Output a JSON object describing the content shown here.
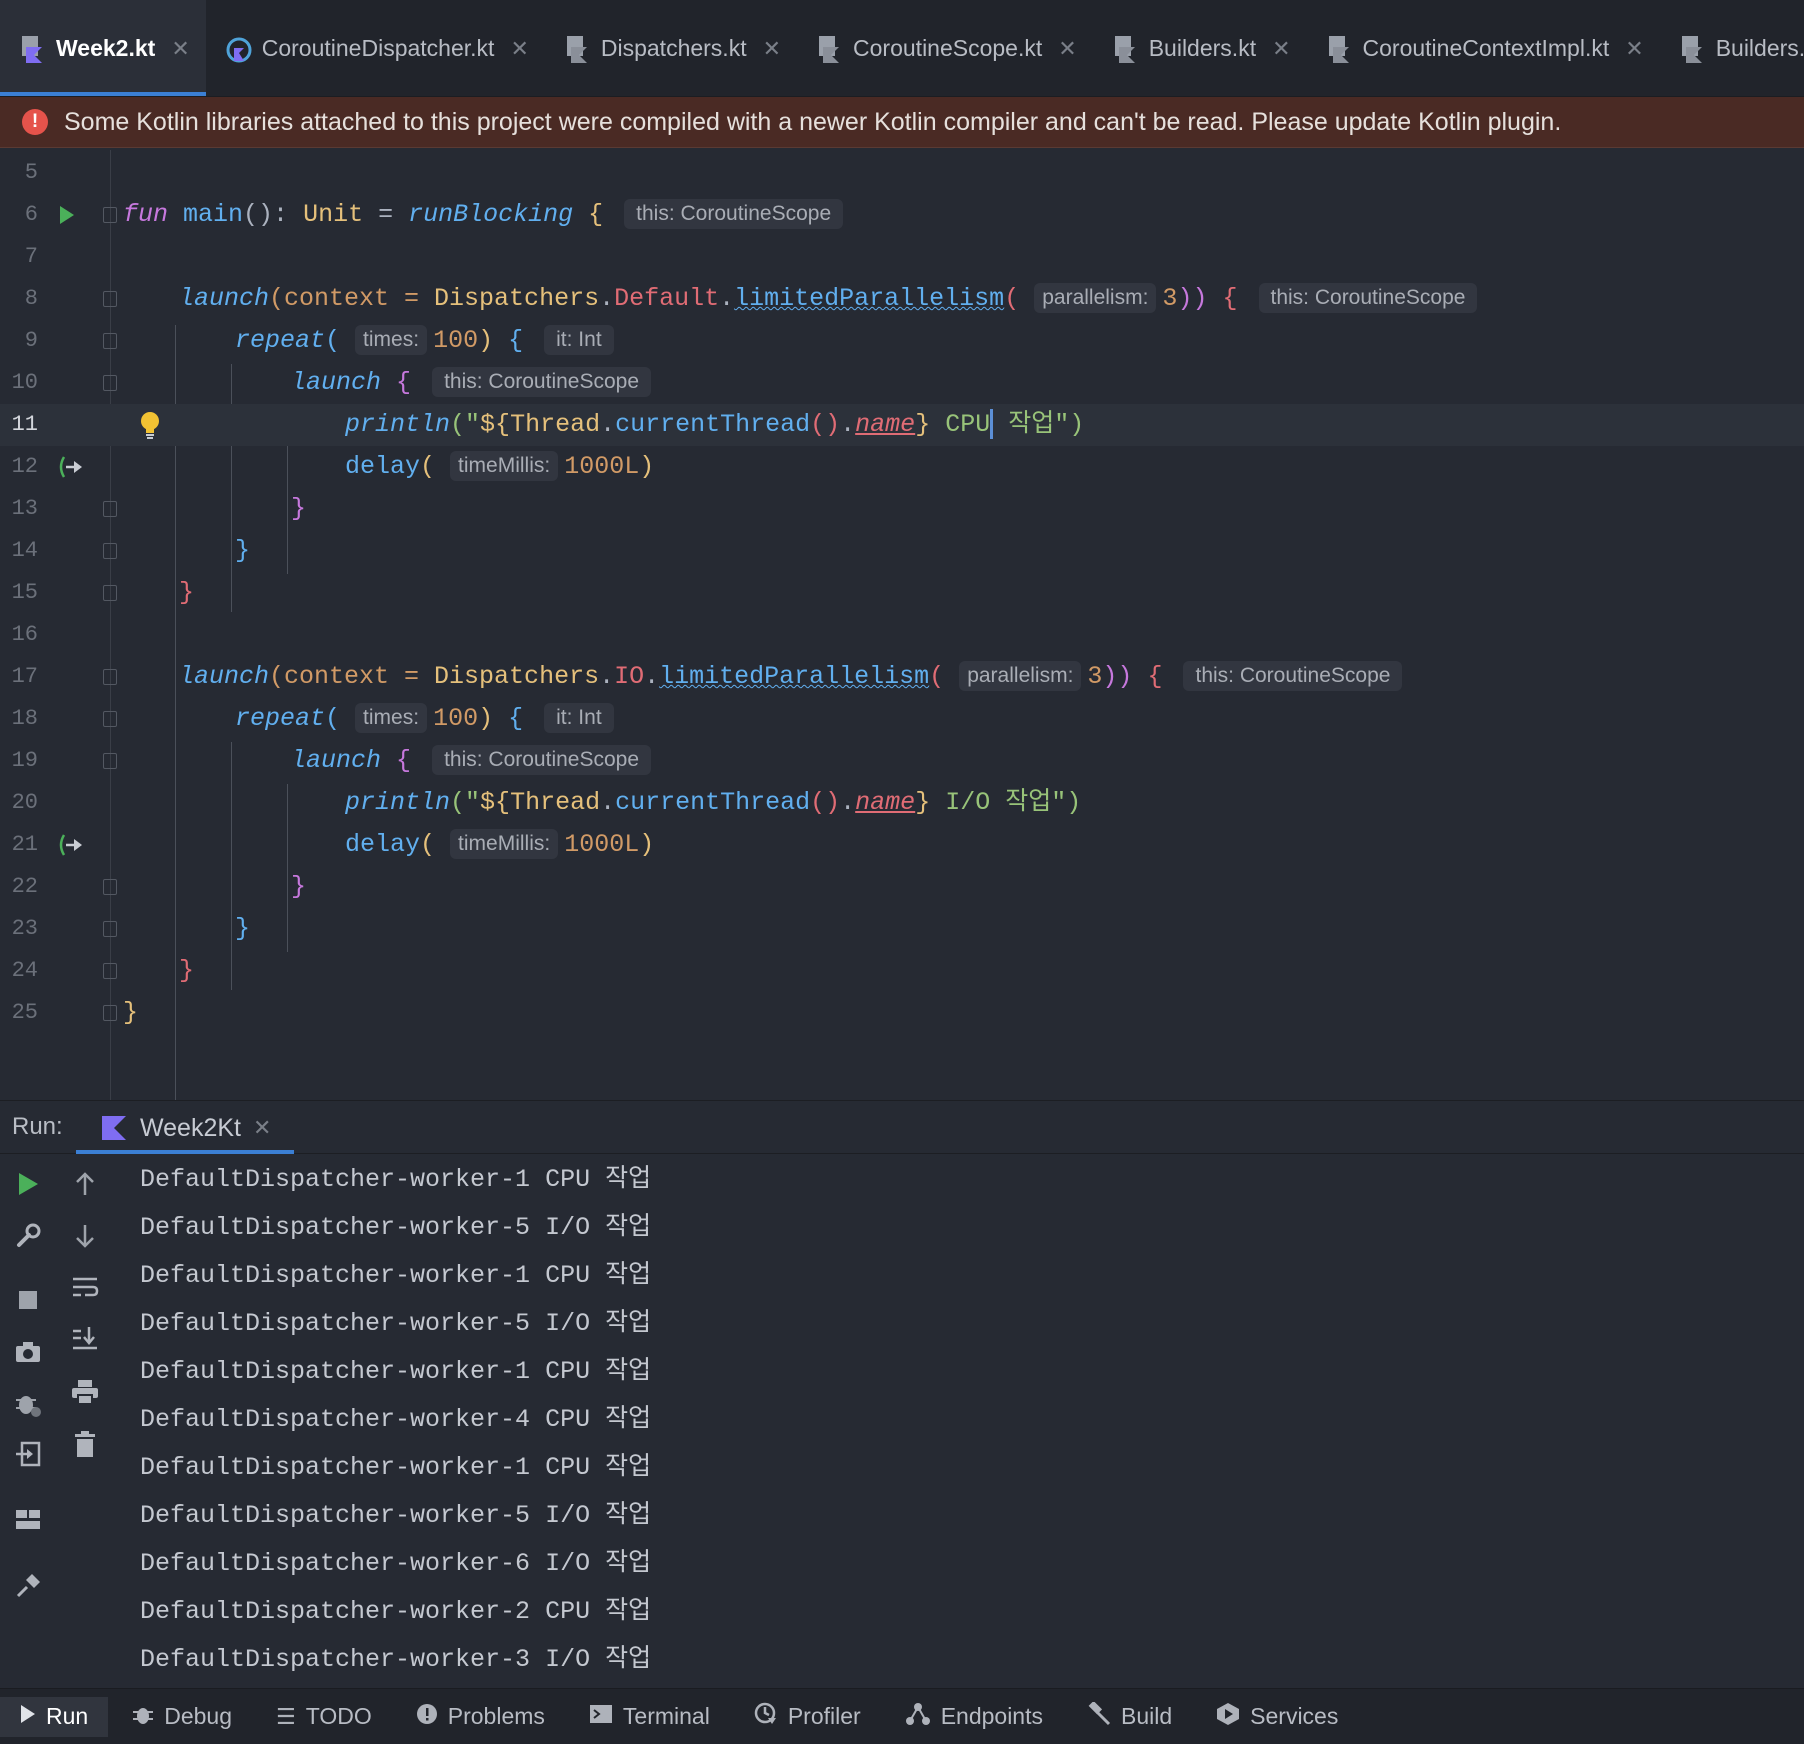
{
  "tabs": [
    {
      "label": "Week2.kt",
      "active": true,
      "icon": "kotlin-file-icon"
    },
    {
      "label": "CoroutineDispatcher.kt",
      "active": false,
      "icon": "kotlin-class-icon"
    },
    {
      "label": "Dispatchers.kt",
      "active": false,
      "icon": "kotlin-file-icon"
    },
    {
      "label": "CoroutineScope.kt",
      "active": false,
      "icon": "kotlin-file-icon"
    },
    {
      "label": "Builders.kt",
      "active": false,
      "icon": "kotlin-file-icon"
    },
    {
      "label": "CoroutineContextImpl.kt",
      "active": false,
      "icon": "kotlin-file-icon"
    },
    {
      "label": "Builders.common.kt",
      "active": false,
      "icon": "kotlin-file-icon"
    }
  ],
  "banner": {
    "icon": "error-icon",
    "message": "Some Kotlin libraries attached to this project were compiled with a newer Kotlin compiler and can't be read. Please update Kotlin plugin."
  },
  "editor": {
    "line_numbers": [
      "5",
      "6",
      "7",
      "8",
      "9",
      "10",
      "11",
      "12",
      "13",
      "14",
      "15",
      "16",
      "17",
      "18",
      "19",
      "20",
      "21",
      "22",
      "23",
      "24",
      "25"
    ],
    "current_line": "11",
    "hints": {
      "scope": "this: CoroutineScope",
      "parallelism": "parallelism:",
      "times": "times:",
      "it": "it: Int",
      "timeMillis": "timeMillis:"
    },
    "code": {
      "fun": "fun",
      "main": "main",
      "unit_sig": "(): ",
      "unit": "Unit",
      "eq": " = ",
      "runBlocking": "runBlocking",
      "launch": "launch",
      "context_eq": "(context = ",
      "dispatchers": "Dispatchers",
      "dot": ".",
      "default": "Default",
      "io": "IO",
      "limited": "limitedParallelism",
      "three": "3",
      "repeat": "repeat",
      "hundred": "100",
      "println": "println",
      "str_open": "(\"",
      "interp_open": "${",
      "thread": "Thread",
      "current_thread": "currentThread",
      "parens": "()",
      "name": "name",
      "interp_close": "}",
      "cpu_text": " CPU",
      "cpu_rest": " 작업",
      "io_text": " I/O 작업",
      "str_close": "\")",
      "delay": "delay",
      "delay_val": "1000L",
      "open_brace": "{",
      "close_brace": "}",
      "lparen": "(",
      "rparen": ")",
      "rparen2": "))"
    }
  },
  "run_panel": {
    "label": "Run:",
    "tab": "Week2Kt",
    "output": [
      "DefaultDispatcher-worker-1 CPU 작업",
      "DefaultDispatcher-worker-5 I/O 작업",
      "DefaultDispatcher-worker-1 CPU 작업",
      "DefaultDispatcher-worker-5 I/O 작업",
      "DefaultDispatcher-worker-1 CPU 작업",
      "DefaultDispatcher-worker-4 CPU 작업",
      "DefaultDispatcher-worker-1 CPU 작업",
      "DefaultDispatcher-worker-5 I/O 작업",
      "DefaultDispatcher-worker-6 I/O 작업",
      "DefaultDispatcher-worker-2 CPU 작업",
      "DefaultDispatcher-worker-3 I/O 작업"
    ]
  },
  "bottom_bar": [
    {
      "label": "Run",
      "icon": "play-icon",
      "active": true
    },
    {
      "label": "Debug",
      "icon": "bug-icon",
      "active": false
    },
    {
      "label": "TODO",
      "icon": "list-icon",
      "active": false
    },
    {
      "label": "Problems",
      "icon": "warning-circle-icon",
      "active": false
    },
    {
      "label": "Terminal",
      "icon": "terminal-icon",
      "active": false
    },
    {
      "label": "Profiler",
      "icon": "profiler-icon",
      "active": false
    },
    {
      "label": "Endpoints",
      "icon": "endpoints-icon",
      "active": false
    },
    {
      "label": "Build",
      "icon": "hammer-icon",
      "active": false
    },
    {
      "label": "Services",
      "icon": "services-icon",
      "active": false
    }
  ],
  "colors": {
    "accent": "#3b7fd4",
    "run_green": "#4bb05a",
    "error_red": "#e5534b",
    "keyword": "#c678dd",
    "function": "#61afef",
    "type": "#e5c07b",
    "number": "#d19a66",
    "string": "#98c379"
  }
}
